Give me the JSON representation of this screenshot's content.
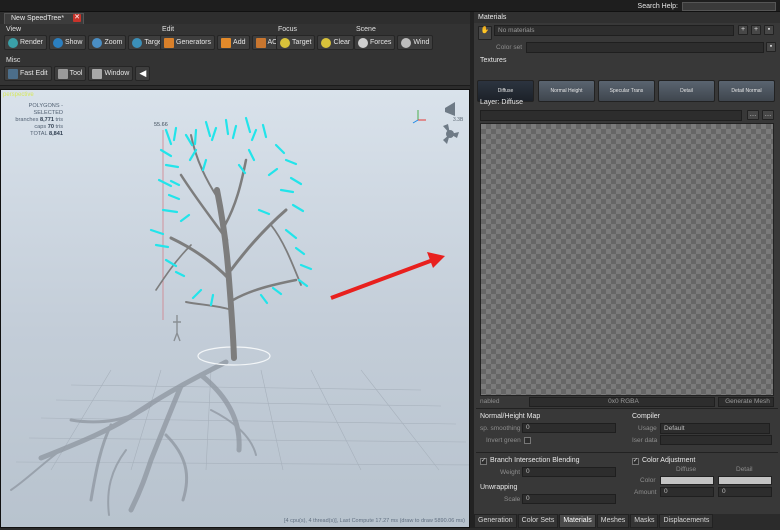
{
  "search": {
    "label": "Search Help:"
  },
  "document_tab": {
    "title": "New SpeedTree*"
  },
  "toolbar": {
    "view": {
      "title": "View",
      "buttons": [
        "Render",
        "Show",
        "Zoom",
        "Target"
      ]
    },
    "edit": {
      "title": "Edit",
      "buttons": [
        "Generators",
        "Add",
        "AO"
      ]
    },
    "focus": {
      "title": "Focus",
      "buttons": [
        "Target",
        "Clear"
      ]
    },
    "scene": {
      "title": "Scene",
      "buttons": [
        "Forces",
        "Wind"
      ]
    },
    "misc": {
      "title": "Misc",
      "buttons": [
        "Fast Edit",
        "Tool",
        "Window"
      ]
    }
  },
  "viewport": {
    "name": "perspective",
    "stats": {
      "heading": "POLYGONS - SELECTED",
      "branches_label": "branches",
      "branches_value": "8,771",
      "caps_label": "caps",
      "caps_value": "70",
      "total_label": "TOTAL",
      "total_value": "8,841",
      "unit": "tris"
    },
    "height_label": "55.66",
    "gizmo_label": "3.3B",
    "status": "[4 cpu(s), 4 thread(s)], Last Compute 17.27 ms (draw to draw 5890.06 ms)"
  },
  "colors": {
    "leaf_highlight": "#22e4ea",
    "arrow": "#e8201e",
    "trunk": "#7d7d7d"
  },
  "materials": {
    "title": "Materials",
    "select_value": "No materials",
    "color_set_label": "Color set",
    "textures_label": "Textures",
    "texture_buttons": [
      "Diffuse",
      "Normal Height",
      "Specular Trans",
      "Detail",
      "Detail Normal"
    ],
    "layer_label": "Layer: Diffuse",
    "enabled_label": "nabled",
    "info_label": "0x0 RGBA",
    "generate_mesh_label": "Generate Mesh"
  },
  "normal_height": {
    "title": "Normal/Height Map",
    "sp_smoothing_label": "sp. smoothing",
    "sp_smoothing_value": "0",
    "invert_green_label": "Invert green"
  },
  "compiler": {
    "title": "Compiler",
    "usage_label": "Usage",
    "usage_value": "Default",
    "user_data_label": "Iser data"
  },
  "branch_blending": {
    "title": "Branch Intersection Blending",
    "weight_label": "Weight",
    "weight_value": "0"
  },
  "color_adjustment": {
    "title": "Color Adjustment",
    "col_diffuse": "Diffuse",
    "col_detail": "Detail",
    "color_label": "Color",
    "amount_label": "Amount",
    "amount_diffuse": "0",
    "amount_detail": "0"
  },
  "unwrapping": {
    "title": "Unwrapping",
    "scale_label": "Scale",
    "scale_value": "0"
  },
  "bottom_tabs": [
    "Generation",
    "Color Sets",
    "Materials",
    "Meshes",
    "Masks",
    "Displacements"
  ]
}
